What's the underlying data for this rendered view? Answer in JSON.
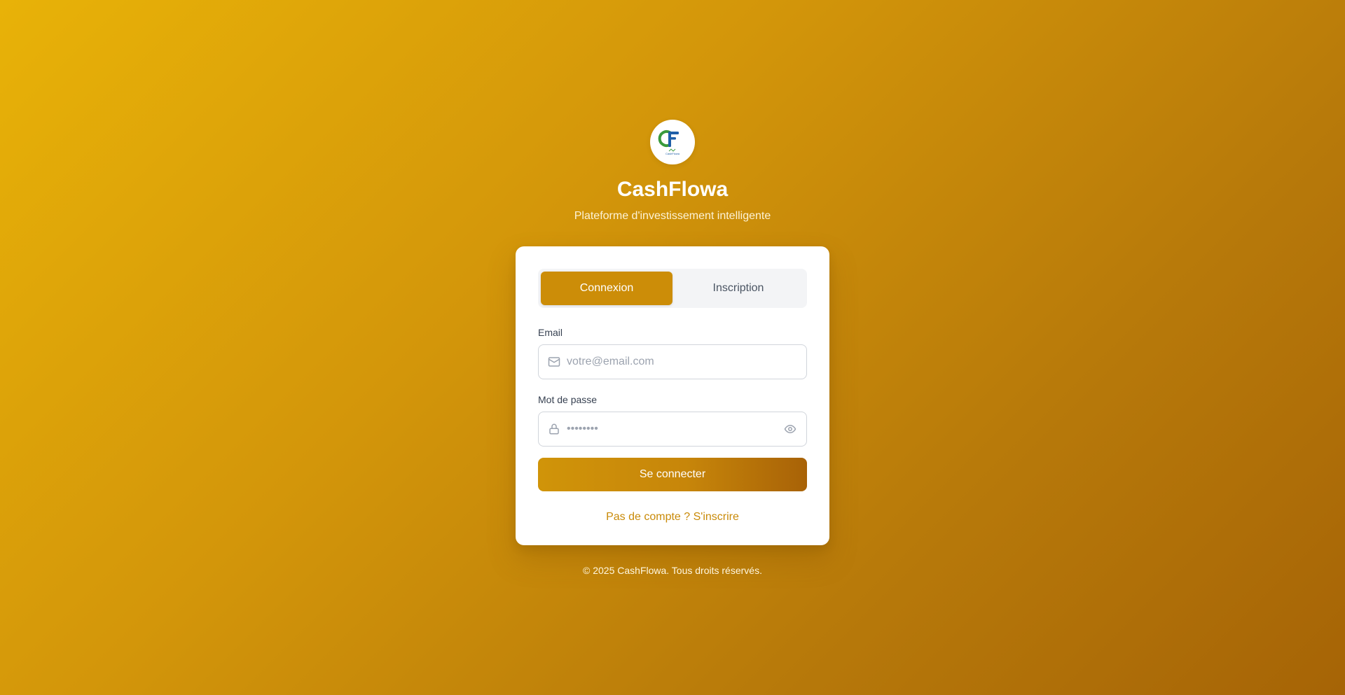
{
  "brand": {
    "logo_text": "CashFlowa",
    "title": "CashFlowa",
    "subtitle": "Plateforme d'investissement intelligente"
  },
  "tabs": [
    {
      "label": "Connexion",
      "active": true
    },
    {
      "label": "Inscription",
      "active": false
    }
  ],
  "form": {
    "email": {
      "label": "Email",
      "placeholder": "votre@email.com",
      "value": "",
      "icon": "mail-icon"
    },
    "password": {
      "label": "Mot de passe",
      "placeholder": "••••••••",
      "value": "",
      "icon": "lock-icon",
      "toggle_icon": "eye-icon"
    },
    "submit_label": "Se connecter",
    "switch_link": "Pas de compte ? S'inscrire"
  },
  "footer": {
    "copyright": "© 2025 CashFlowa. Tous droits réservés."
  },
  "colors": {
    "accent": "#cc8d08",
    "link": "#c98a08",
    "background_start": "#e8b208",
    "background_end": "#a66406"
  }
}
